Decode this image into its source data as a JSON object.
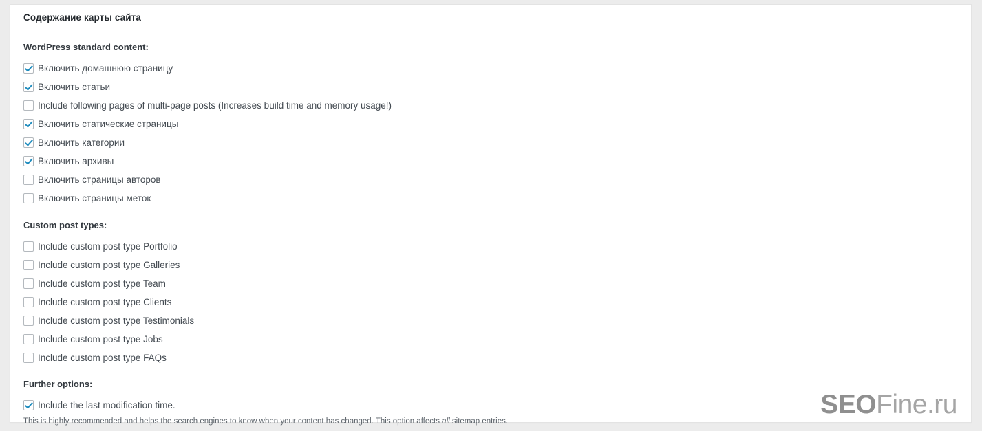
{
  "panel": {
    "title": "Содержание карты сайта"
  },
  "sections": {
    "standard": {
      "heading": "WordPress standard content:",
      "options": [
        {
          "label": "Включить домашнюю страницу",
          "checked": true
        },
        {
          "label": "Включить статьи",
          "checked": true
        },
        {
          "label": "Include following pages of multi-page posts (Increases build time and memory usage!)",
          "checked": false
        },
        {
          "label": "Включить статические страницы",
          "checked": true
        },
        {
          "label": "Включить категории",
          "checked": true
        },
        {
          "label": "Включить архивы",
          "checked": true
        },
        {
          "label": "Включить страницы авторов",
          "checked": false
        },
        {
          "label": "Включить страницы меток",
          "checked": false
        }
      ]
    },
    "custom": {
      "heading": "Custom post types:",
      "options": [
        {
          "label": "Include custom post type Portfolio",
          "checked": false
        },
        {
          "label": "Include custom post type Galleries",
          "checked": false
        },
        {
          "label": "Include custom post type Team",
          "checked": false
        },
        {
          "label": "Include custom post type Clients",
          "checked": false
        },
        {
          "label": "Include custom post type Testimonials",
          "checked": false
        },
        {
          "label": "Include custom post type Jobs",
          "checked": false
        },
        {
          "label": "Include custom post type FAQs",
          "checked": false
        }
      ]
    },
    "further": {
      "heading": "Further options:",
      "options": [
        {
          "label": "Include the last modification time.",
          "checked": true
        }
      ],
      "description_before": "This is highly recommended and helps the search engines to know when your content has changed. This option affects ",
      "description_emphasis": "all",
      "description_after": " sitemap entries."
    }
  },
  "watermark": {
    "bold_part": "SEO",
    "light_part": "Fine.ru"
  },
  "colors": {
    "page_background": "#ececec",
    "panel_background": "#ffffff",
    "panel_border": "#e3e3e3",
    "checkbox_accent": "#1e8cbe",
    "checkbox_border": "#b4b9be",
    "heading_text": "#23282d",
    "label_text": "#444b52",
    "description_text": "#5d646b"
  }
}
